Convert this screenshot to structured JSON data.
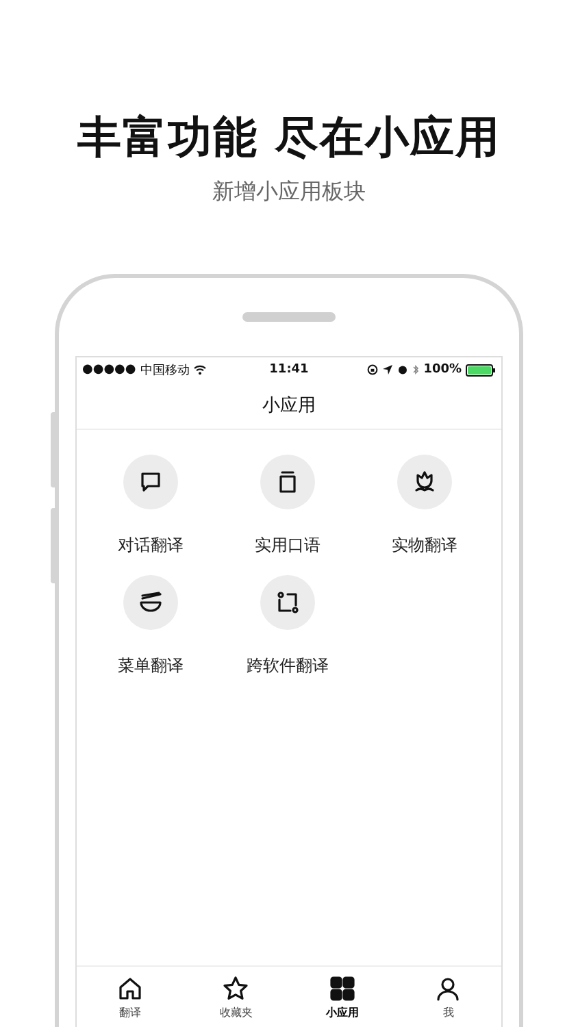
{
  "headline": "丰富功能 尽在小应用",
  "subtitle": "新增小应用板块",
  "status_bar": {
    "signal": "●●●●●",
    "carrier": "中国移动",
    "time": "11:41",
    "battery": "100%"
  },
  "nav_title": "小应用",
  "apps": [
    {
      "label": "对话翻译",
      "kind": "chat"
    },
    {
      "label": "实用口语",
      "kind": "card"
    },
    {
      "label": "实物翻译",
      "kind": "flower"
    },
    {
      "label": "菜单翻译",
      "kind": "bowl"
    },
    {
      "label": "跨软件翻译",
      "kind": "crop"
    }
  ],
  "tabs": [
    {
      "label": "翻译",
      "kind": "home",
      "selected": false
    },
    {
      "label": "收藏夹",
      "kind": "star",
      "selected": false
    },
    {
      "label": "小应用",
      "kind": "grid",
      "selected": true
    },
    {
      "label": "我",
      "kind": "user",
      "selected": false
    }
  ]
}
